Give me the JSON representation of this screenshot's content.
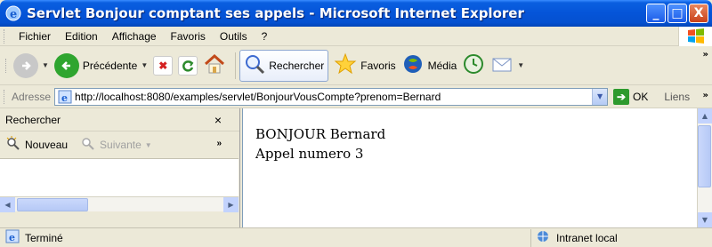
{
  "window": {
    "title": "Servlet Bonjour comptant ses appels - Microsoft Internet Explorer",
    "buttons": {
      "minimize": "_",
      "maximize": "□",
      "close": "X"
    }
  },
  "menubar": {
    "items": [
      {
        "label": "Fichier"
      },
      {
        "label": "Edition"
      },
      {
        "label": "Affichage"
      },
      {
        "label": "Favoris"
      },
      {
        "label": "Outils"
      },
      {
        "label": "?"
      }
    ]
  },
  "toolbar": {
    "back_label": "Précédente",
    "search_label": "Rechercher",
    "favorites_label": "Favoris",
    "media_label": "Média",
    "overflow": "»"
  },
  "addressbar": {
    "label": "Adresse",
    "url": "http://localhost:8080/examples/servlet/BonjourVousCompte?prenom=Bernard",
    "go_label": "OK",
    "links_label": "Liens",
    "overflow": "»"
  },
  "sidebar": {
    "title": "Rechercher",
    "close": "×",
    "new_label": "Nouveau",
    "next_label": "Suivante",
    "overflow": "»"
  },
  "content": {
    "line1": "BONJOUR Bernard",
    "line2": "Appel numero 3"
  },
  "statusbar": {
    "status": "Terminé",
    "zone": "Intranet local"
  },
  "colors": {
    "titlebar": "#0554d8",
    "chrome": "#ece9d8",
    "back_green": "#2fa52f"
  }
}
